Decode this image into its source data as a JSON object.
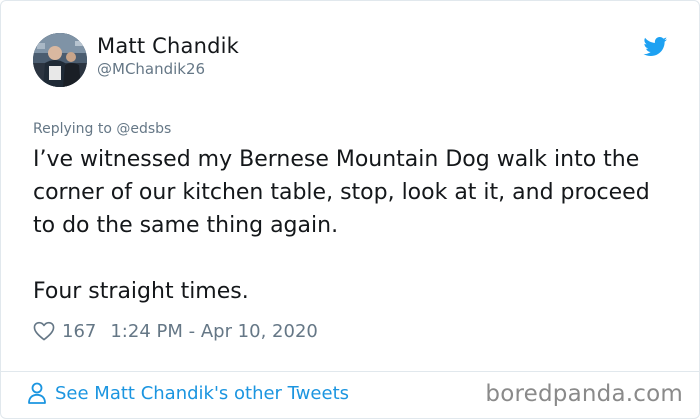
{
  "author": {
    "display_name": "Matt Chandik",
    "handle": "@MChandik26",
    "avatar_icon": "profile-photo"
  },
  "tweet": {
    "reply_to": "Replying to @edsbs",
    "paragraphs": [
      "I’ve witnessed my Bernese Mountain Dog walk into the corner of our kitchen table, stop, look at it, and proceed to do the same thing again.",
      "Four straight times."
    ],
    "like_count": "167",
    "timestamp": "1:24 PM - Apr 10, 2020"
  },
  "footer": {
    "see_more_label": "See Matt Chandik's other Tweets",
    "watermark": "boredpanda.com"
  },
  "colors": {
    "twitter_blue": "#1da1f2",
    "link_blue": "#1b95e0",
    "muted_gray": "#657786",
    "text_dark": "#14171a"
  },
  "icons": {
    "brand": "twitter-bird-icon",
    "like": "heart-icon",
    "profile": "person-icon"
  }
}
